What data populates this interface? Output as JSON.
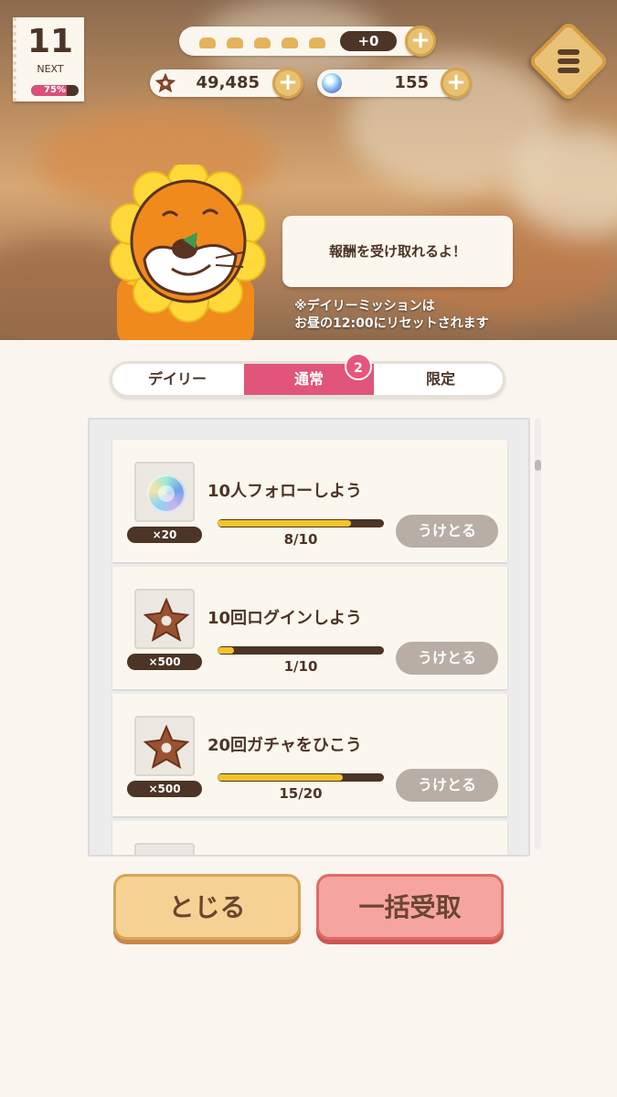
{
  "header": {
    "level": "11",
    "next_label": "NEXT",
    "level_progress": 0.75,
    "level_progress_text": "75%",
    "stamina_count": "+0",
    "coins": "49,485",
    "gems": "155"
  },
  "speech": {
    "bubble_text": "報酬を受け取れるよ！",
    "notice_line1": "※デイリーミッションは",
    "notice_line2": "お昼の12:00にリセットされます"
  },
  "tabs": [
    {
      "label": "デイリー",
      "active": false
    },
    {
      "label": "通常",
      "active": true,
      "badge": "2"
    },
    {
      "label": "限定",
      "active": false
    }
  ],
  "missions": [
    {
      "title": "10人フォローしよう",
      "reward_icon": "gem-icon",
      "quantity": "×20",
      "progress_text": "8/10",
      "progress": 0.8,
      "button": "うけとる"
    },
    {
      "title": "10回ログインしよう",
      "reward_icon": "cookie-coin-icon",
      "quantity": "×500",
      "progress_text": "1/10",
      "progress": 0.1,
      "button": "うけとる"
    },
    {
      "title": "20回ガチャをひこう",
      "reward_icon": "cookie-coin-icon",
      "quantity": "×500",
      "progress_text": "15/20",
      "progress": 0.75,
      "button": "うけとる"
    }
  ],
  "buttons": {
    "close": "とじる",
    "bulk_claim": "一括受取"
  },
  "colors": {
    "accent_pink": "#e05579",
    "dark_brown": "#4c3426",
    "progress_yellow": "#f2c329"
  }
}
